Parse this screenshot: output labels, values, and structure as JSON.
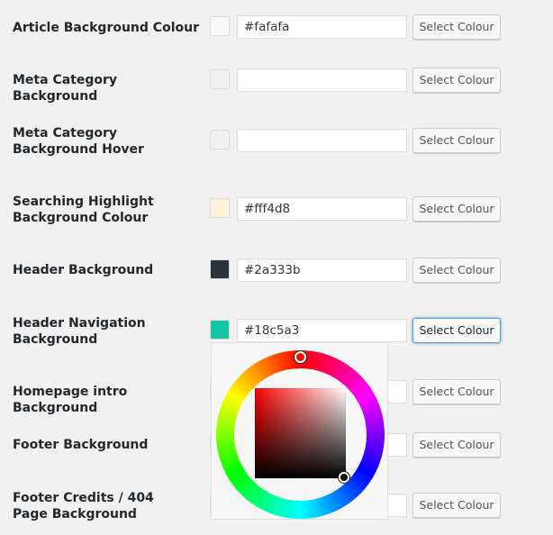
{
  "select_label": "Select Colour",
  "rows": [
    {
      "label": "Article Background Colour",
      "swatch": "#fafafa",
      "value": "#fafafa"
    },
    {
      "label": "Meta Category Background",
      "swatch": "#f1f1f1",
      "value": ""
    },
    {
      "label": "Meta Category Background Hover",
      "swatch": "#f1f1f1",
      "value": ""
    },
    {
      "label": "Searching Highlight Background Colour",
      "swatch": "#fff4d8",
      "value": "#fff4d8"
    },
    {
      "label": "Header Background",
      "swatch": "#2a333b",
      "value": "#2a333b"
    },
    {
      "label": "Header Navigation Background",
      "swatch": "#18c5a3",
      "value": "#18c5a3"
    },
    {
      "label": "Homepage intro Background",
      "swatch": "#f1f1f1",
      "value": ""
    },
    {
      "label": "Footer Background",
      "swatch": "#f1f1f1",
      "value": ""
    },
    {
      "label": "Footer Credits / 404 Page Background",
      "swatch": "#f1f1f1",
      "value": ""
    }
  ],
  "color_picker": {
    "open_for": "Header Navigation Background",
    "hue": "red"
  }
}
